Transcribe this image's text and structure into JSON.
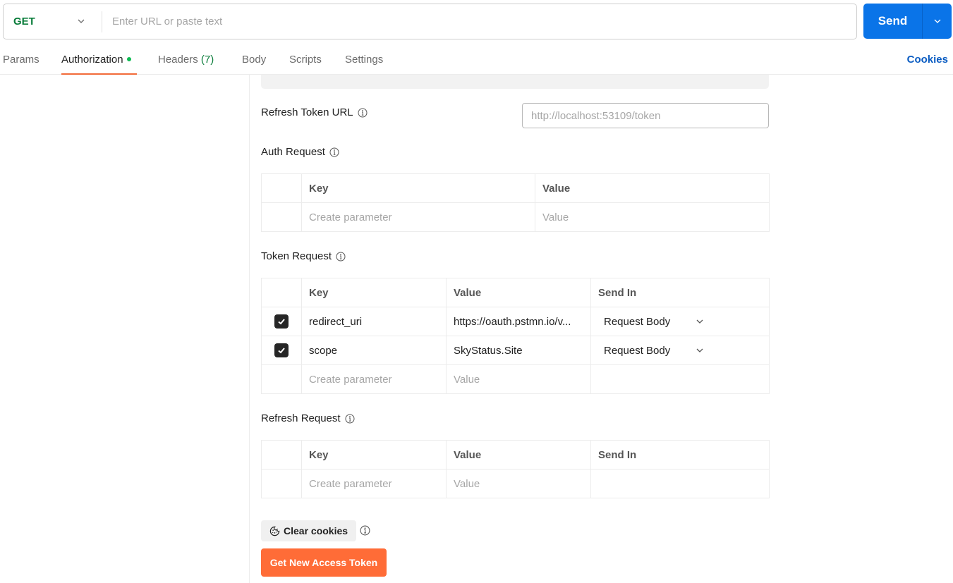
{
  "url_bar": {
    "method": "GET",
    "url_value": "",
    "url_placeholder": "Enter URL or paste text",
    "send_label": "Send"
  },
  "tabs": [
    {
      "label": "Params"
    },
    {
      "label": "Authorization",
      "active": true,
      "status_dot_color": "#0cbb52"
    },
    {
      "label": "Headers",
      "count": "(7)"
    },
    {
      "label": "Body"
    },
    {
      "label": "Scripts"
    },
    {
      "label": "Settings"
    }
  ],
  "cookies_link": "Cookies",
  "refresh_token_url": {
    "label": "Refresh Token URL",
    "value": "",
    "placeholder": "http://localhost:53109/token"
  },
  "auth_request": {
    "label": "Auth Request",
    "headers": [
      "Key",
      "Value"
    ],
    "rows": [],
    "new_row": {
      "key_placeholder": "Create parameter",
      "value_placeholder": "Value"
    }
  },
  "token_request": {
    "label": "Token Request",
    "headers": [
      "Key",
      "Value",
      "Send In"
    ],
    "rows": [
      {
        "checked": true,
        "key": "redirect_uri",
        "value": "https://oauth.pstmn.io/v...",
        "send_in": "Request Body"
      },
      {
        "checked": true,
        "key": "scope",
        "value": "SkyStatus.Site",
        "send_in": "Request Body"
      }
    ],
    "new_row": {
      "key_placeholder": "Create parameter",
      "value_placeholder": "Value"
    }
  },
  "refresh_request": {
    "label": "Refresh Request",
    "headers": [
      "Key",
      "Value",
      "Send In"
    ],
    "rows": [],
    "new_row": {
      "key_placeholder": "Create parameter",
      "value_placeholder": "Value"
    }
  },
  "actions": {
    "clear_cookies": "Clear cookies",
    "get_new_token": "Get New Access Token"
  },
  "colors": {
    "accent_send": "#0a74e8",
    "accent_token_button": "#ff6c37",
    "method_get": "#097c3a",
    "link": "#0a5cc2"
  }
}
